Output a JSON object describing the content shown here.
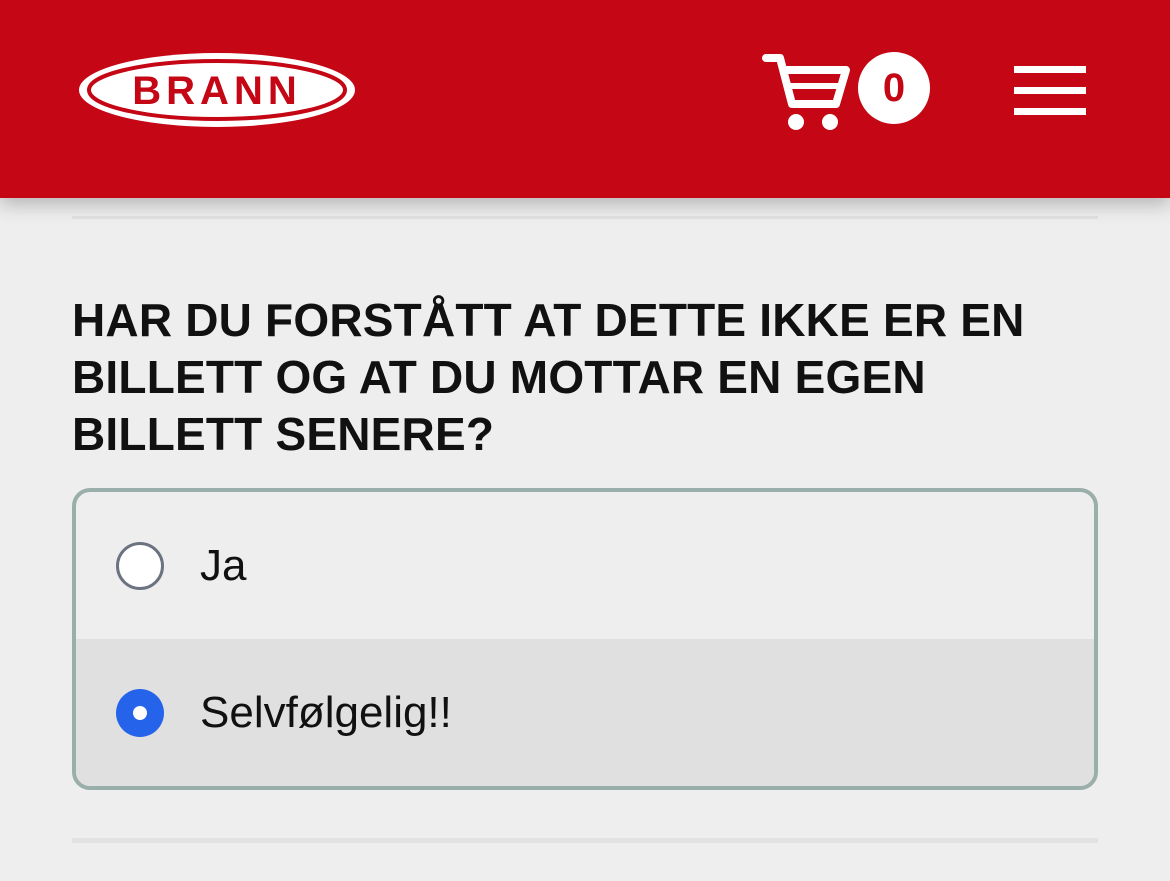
{
  "header": {
    "logo_text": "BRANN",
    "cart_count": "0",
    "brand_color": "#c40615"
  },
  "question": {
    "text": "HAR DU FORSTÅTT AT DETTE IKKE ER EN BILLETT OG AT DU MOTTAR EN EGEN BILLETT SENERE?"
  },
  "options": [
    {
      "label": "Ja",
      "selected": false
    },
    {
      "label": "Selvfølgelig!!",
      "selected": true
    }
  ],
  "icons": {
    "cart": "shopping-cart-icon",
    "menu": "hamburger-menu-icon",
    "radio_accent": "#2563eb"
  }
}
